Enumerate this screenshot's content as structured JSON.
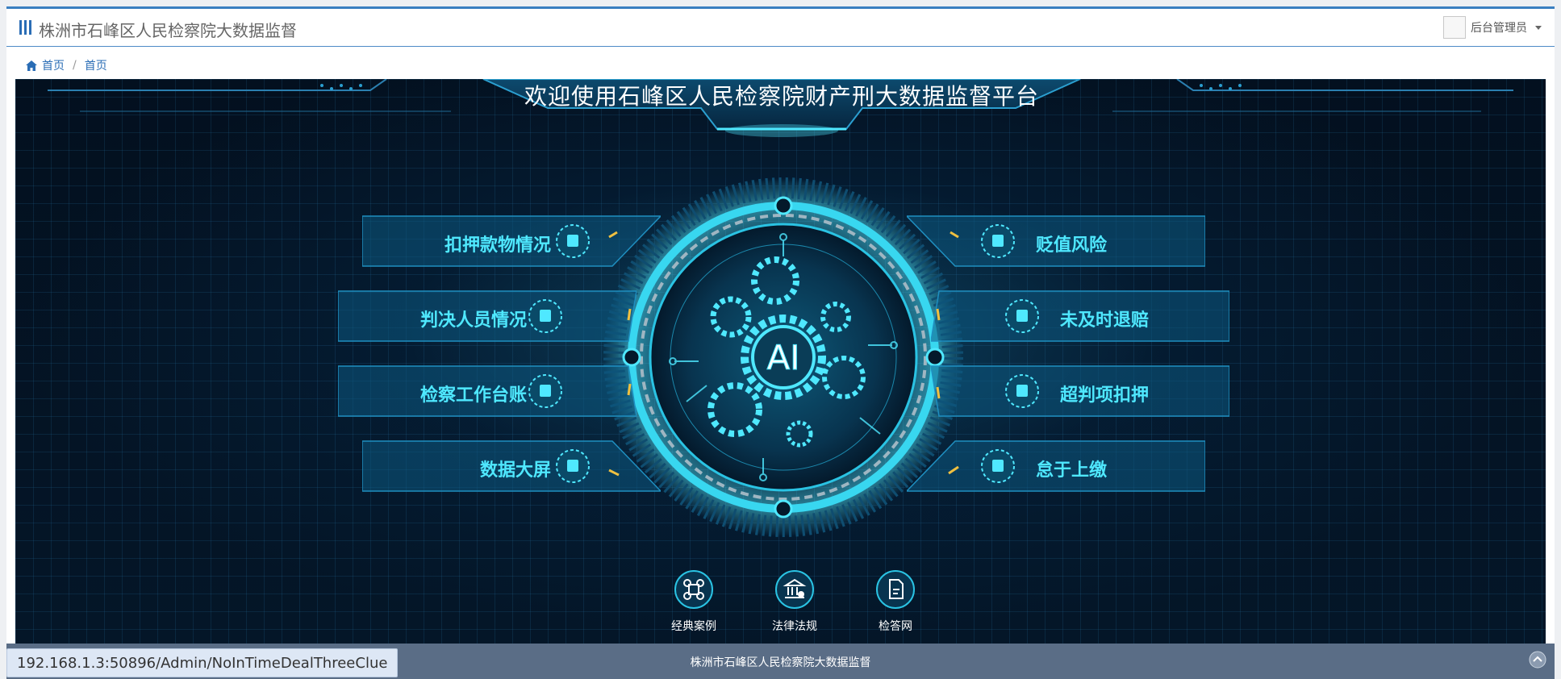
{
  "header": {
    "title": "株洲市石峰区人民检察院大数据监督",
    "admin_name": "后台管理员",
    "menu_icon": "bars-icon",
    "avatar_icon": "broken-image-icon"
  },
  "breadcrumb": {
    "home": "首页",
    "current": "首页"
  },
  "dashboard": {
    "welcome": "欢迎使用石峰区人民检察院财产刑大数据监督平台",
    "center_label": "AI",
    "left_items": [
      "扣押款物情况",
      "判决人员情况",
      "检察工作台账",
      "数据大屏"
    ],
    "right_items": [
      "贬值风险",
      "未及时退赔",
      "超判项扣押",
      "怠于上缴"
    ],
    "bottom_links": [
      {
        "label": "经典案例",
        "icon": "command-icon"
      },
      {
        "label": "法律法规",
        "icon": "courthouse-icon"
      },
      {
        "label": "检答网",
        "icon": "document-icon"
      }
    ],
    "accent": "#4fe8ff",
    "background": "#03101f"
  },
  "footer": {
    "text": "株洲市石峰区人民检察院大数据监督"
  },
  "status_url": "192.168.1.3:50896/Admin/NoInTimeDealThreeClue"
}
